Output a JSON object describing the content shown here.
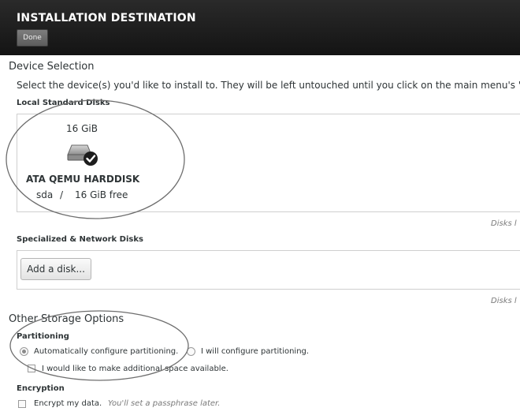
{
  "header": {
    "title": "INSTALLATION DESTINATION",
    "done_label": "Done"
  },
  "device_selection": {
    "title": "Device Selection",
    "instruction": "Select the device(s) you'd like to install to.  They will be left untouched until you click on the main menu's \"Be",
    "local_disks_label": "Local Standard Disks",
    "disk": {
      "size": "16 GiB",
      "name": "ATA QEMU HARDDISK",
      "device": "sda",
      "separator": "/",
      "free": "16 GiB free",
      "icon": "hard-disk-icon",
      "selected": true
    },
    "local_disks_note": "Disks l",
    "specialized_label": "Specialized & Network Disks",
    "add_disk_label": "Add a disk...",
    "specialized_note": "Disks l"
  },
  "other_storage": {
    "title": "Other Storage Options",
    "partitioning_label": "Partitioning",
    "auto_option": "Automatically configure partitioning.",
    "manual_option": "I will configure partitioning.",
    "selected_option": "auto",
    "extra_space_label": "I would like to make additional space available.",
    "extra_space_checked": false,
    "encryption_label": "Encryption",
    "encrypt_label": "Encrypt my data.",
    "encrypt_hint": "You'll set a passphrase later.",
    "encrypt_checked": false
  },
  "colors": {
    "header_bg": "#1e1e1e",
    "annotation": "#6e6e6e"
  }
}
